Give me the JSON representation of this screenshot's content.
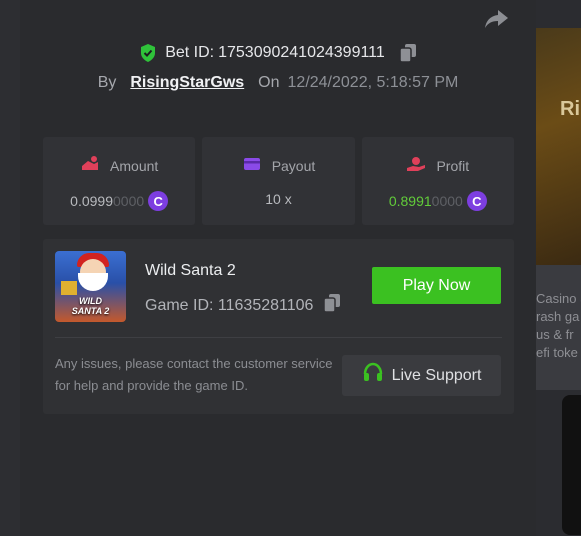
{
  "bet": {
    "id_label": "Bet ID:",
    "id_value": "1753090241024399111"
  },
  "meta": {
    "by_label": "By",
    "username": "RisingStarGws",
    "on_label": "On",
    "datetime": "12/24/2022, 5:18:57 PM"
  },
  "stats": {
    "amount": {
      "label": "Amount",
      "value_main": "0.0999",
      "value_dim": "0000",
      "coin": "C"
    },
    "payout": {
      "label": "Payout",
      "value": "10 x"
    },
    "profit": {
      "label": "Profit",
      "value_main": "0.8991",
      "value_dim": "0000",
      "coin": "C"
    }
  },
  "game": {
    "name": "Wild Santa 2",
    "id_label": "Game ID:",
    "id_value": "11635281106",
    "thumb_label_line1": "WILD",
    "thumb_label_line2": "SANTA 2",
    "play_button": "Play Now"
  },
  "support": {
    "text": "Any issues, please contact the customer service for help and provide the game ID.",
    "button": "Live Support"
  },
  "background": {
    "banner_letters": "Ri",
    "side_lines": [
      "Casino S",
      "rash ga",
      "us & fr",
      "efi toke"
    ]
  },
  "colors": {
    "accent_green": "#3bc121",
    "coin_purple": "#7d3ee0",
    "profit_green": "#62cc3a"
  },
  "icons": [
    "share-icon",
    "shield-check-icon",
    "copy-icon",
    "amount-icon",
    "payout-icon",
    "profit-icon",
    "headset-icon"
  ]
}
